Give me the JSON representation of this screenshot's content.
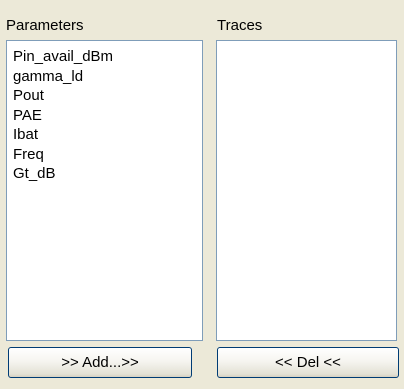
{
  "parameters_panel": {
    "label": "Parameters",
    "items": [
      "Pin_avail_dBm",
      "gamma_ld",
      "Pout",
      "PAE",
      "Ibat",
      "Freq",
      "Gt_dB"
    ]
  },
  "traces_panel": {
    "label": "Traces",
    "items": []
  },
  "buttons": {
    "add_label": ">> Add...>>",
    "del_label": "<< Del <<"
  }
}
